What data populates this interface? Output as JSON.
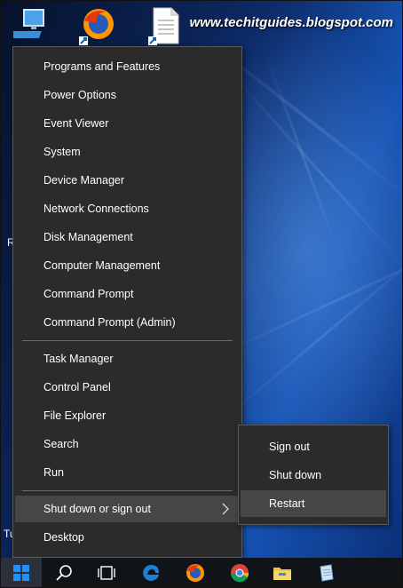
{
  "watermark": "www.techitguides.blogspot.com",
  "desktop": {
    "icons": [
      "computer-icon",
      "firefox-shortcut-icon",
      "document-shortcut-icon"
    ],
    "edge_labels": [
      "R",
      "Tu"
    ]
  },
  "menu": {
    "group1": [
      "Programs and Features",
      "Power Options",
      "Event Viewer",
      "System",
      "Device Manager",
      "Network Connections",
      "Disk Management",
      "Computer Management",
      "Command Prompt",
      "Command Prompt (Admin)"
    ],
    "group2": [
      "Task Manager",
      "Control Panel",
      "File Explorer",
      "Search",
      "Run"
    ],
    "shutdown": "Shut down or sign out",
    "desktop": "Desktop"
  },
  "submenu": {
    "items": [
      "Sign out",
      "Shut down",
      "Restart"
    ],
    "highlighted": "Restart"
  },
  "taskbar": {
    "buttons": [
      "start-icon",
      "search-icon",
      "task-view-icon",
      "edge-icon",
      "firefox-icon",
      "chrome-icon",
      "file-explorer-icon",
      "notepad-icon"
    ]
  },
  "colors": {
    "menu_bg": "#2b2b2b",
    "menu_highlight": "#464646",
    "taskbar_bg": "#101418",
    "start_blue": "#1e90ff"
  }
}
